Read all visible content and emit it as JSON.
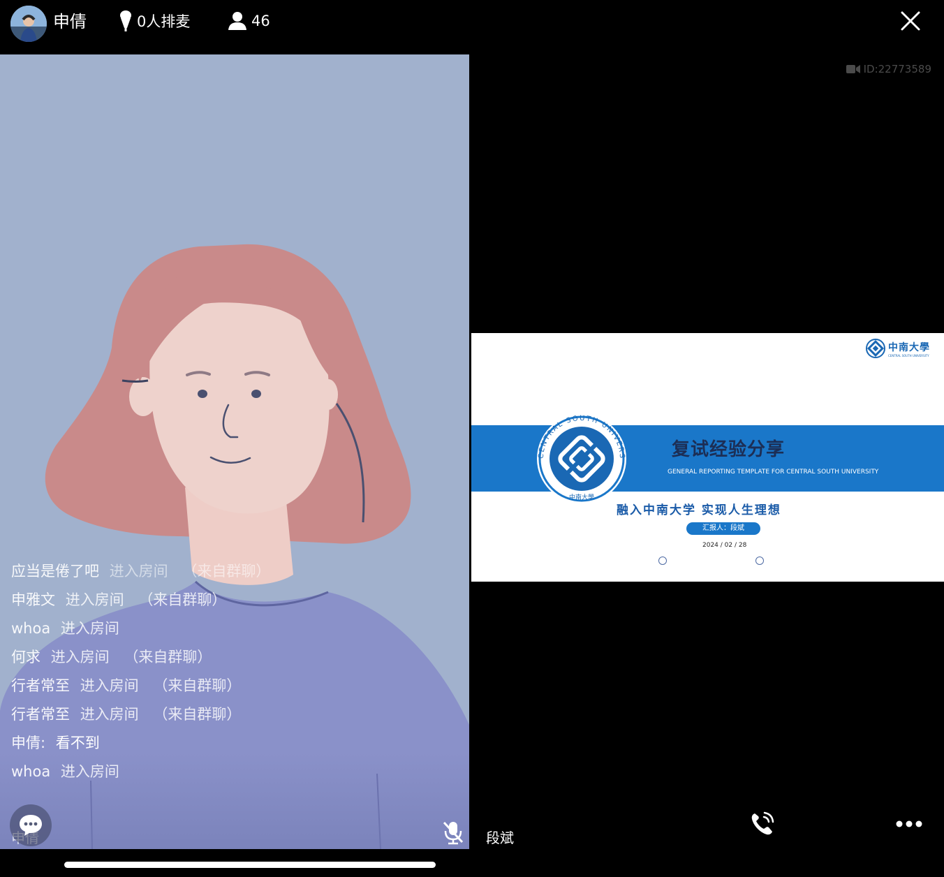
{
  "header": {
    "host_name": "申倩",
    "mic_queue": "0人排麦",
    "viewer_count": "46",
    "icons": {
      "mic": "microphone-icon",
      "viewers": "person-icon",
      "close": "close-icon"
    }
  },
  "left_stream": {
    "user_name": "申倩",
    "chat_messages": [
      {
        "user": "应当是倦了吧",
        "text": "进入房间",
        "tag": "（来自群聊）",
        "style": "faded"
      },
      {
        "user": "申雅文",
        "text": "进入房间",
        "tag": "（来自群聊）",
        "style": "normal"
      },
      {
        "user": "whoa",
        "text": "进入房间",
        "tag": "",
        "style": "normal"
      },
      {
        "user": "何求",
        "text": "进入房间",
        "tag": "（来自群聊）",
        "style": "normal"
      },
      {
        "user": "行者常至",
        "text": "进入房间",
        "tag": "（来自群聊）",
        "style": "normal"
      },
      {
        "user": "行者常至",
        "text": "进入房间",
        "tag": "（来自群聊）",
        "style": "normal"
      },
      {
        "user": "申倩:",
        "text": "看不到",
        "tag": "",
        "style": "message"
      },
      {
        "user": "whoa",
        "text": "进入房间",
        "tag": "",
        "style": "normal"
      }
    ],
    "icons": {
      "chat": "chat-bubble-icon",
      "mic_muted": "mic-muted-icon"
    },
    "colors": {
      "background": "#a1b1cd",
      "hair": "#c98a8a",
      "sweater": "#8a91c9"
    }
  },
  "right_stream": {
    "room_id": "ID:22773589",
    "user_name": "段斌",
    "slide": {
      "logo_cn": "中南大學",
      "logo_en": "CENTRAL SOUTH UNIVERSITY",
      "emblem_text": "CENTRAL SOUTH UNIVERSITY",
      "emblem_cn": "中南大學",
      "title": "复试经验分享",
      "subtitle_en": "GENERAL REPORTING TEMPLATE FOR CENTRAL SOUTH UNIVERSITY",
      "motto": "融入中南大学  实现人生理想",
      "reporter": "汇报人：段斌",
      "date": "2024 / 02 / 28",
      "band_color": "#1a77c9"
    },
    "icons": {
      "camera": "video-camera-icon",
      "call": "phone-call-icon",
      "more": "more-dots-icon"
    }
  }
}
